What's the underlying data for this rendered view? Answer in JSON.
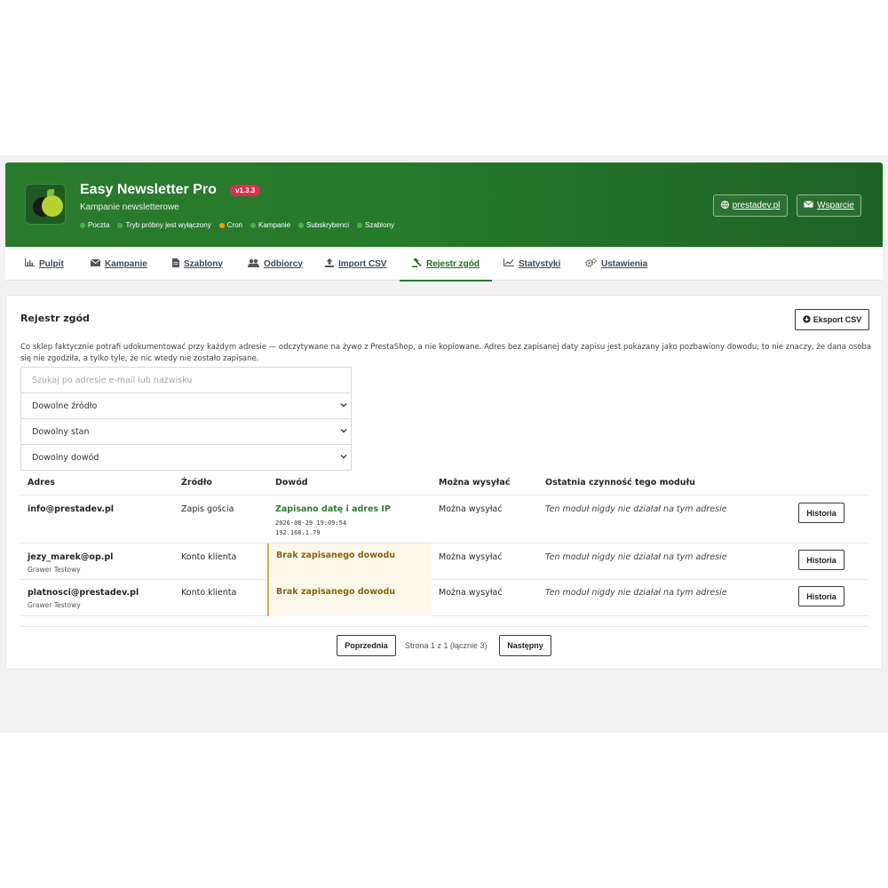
{
  "header": {
    "title": "Easy Newsletter Pro",
    "version": "v1.3.3",
    "subtitle": "Kampanie newsletterowe",
    "status": [
      {
        "label": "Poczta",
        "color": "#4caf50"
      },
      {
        "label": "Tryb próbny jest wyłączony",
        "color": "#4caf50"
      },
      {
        "label": "Cron",
        "color": "#ff9800"
      },
      {
        "label": "Kampanie",
        "color": "#4caf50"
      },
      {
        "label": "Subskrybenci",
        "color": "#4caf50"
      },
      {
        "label": "Szablony",
        "color": "#4caf50"
      }
    ],
    "site_link": "prestadev.pl",
    "support_link": "Wsparcie"
  },
  "tabs": [
    {
      "label": "Pulpit",
      "icon": "bar-chart-icon"
    },
    {
      "label": "Kampanie",
      "icon": "envelope-icon"
    },
    {
      "label": "Szablony",
      "icon": "document-icon"
    },
    {
      "label": "Odbiorcy",
      "icon": "users-icon"
    },
    {
      "label": "Import CSV",
      "icon": "upload-icon"
    },
    {
      "label": "Rejestr zgód",
      "icon": "gavel-icon",
      "active": true
    },
    {
      "label": "Statystyki",
      "icon": "line-chart-icon"
    },
    {
      "label": "Ustawienia",
      "icon": "gears-icon"
    }
  ],
  "panel": {
    "title": "Rejestr zgód",
    "export_label": "Eksport CSV",
    "description": "Co sklep faktycznie potrafi udokumentować przy każdym adresie — odczytywane na żywo z PrestaShop, a nie kopiowane. Adres bez zapisanej daty zapisu jest pokazany jako pozbawiony dowodu; to nie znaczy, że dana osoba się nie zgodziła, a tylko tyle, że nic wtedy nie zostało zapisane."
  },
  "filters": {
    "search_placeholder": "Szukaj po adresie e-mail lub nazwisku",
    "source_selected": "Dowolne źródło",
    "state_selected": "Dowolny stan",
    "proof_selected": "Dowolny dowód"
  },
  "table": {
    "headers": [
      "Adres",
      "Źródło",
      "Dowód",
      "Można wysyłać",
      "Ostatnia czynność tego modułu"
    ],
    "rows": [
      {
        "email": "info@prestadev.pl",
        "name": "",
        "source": "Zapis gościa",
        "proof": "Zapisano datę i adres IP",
        "proof_date": "2026-08-29 19:09:54",
        "proof_ip": "192.168.1.79",
        "proof_ok": true,
        "can_send": "Można wysyłać",
        "last_action": "Ten moduł nigdy nie działał na tym adresie",
        "button": "Historia"
      },
      {
        "email": "jezy_marek@op.pl",
        "name": "Grawer Testowy",
        "source": "Konto klienta",
        "proof": "Brak zapisanego dowodu",
        "proof_ok": false,
        "can_send": "Można wysyłać",
        "last_action": "Ten moduł nigdy nie działał na tym adresie",
        "button": "Historia"
      },
      {
        "email": "platnosci@prestadev.pl",
        "name": "Grawer Testowy",
        "source": "Konto klienta",
        "proof": "Brak zapisanego dowodu",
        "proof_ok": false,
        "can_send": "Można wysyłać",
        "last_action": "Ten moduł nigdy nie działał na tym adresie",
        "button": "Historia"
      }
    ]
  },
  "pager": {
    "prev": "Poprzednia",
    "info": "Strona 1 z 1 (łącznie 3)",
    "next": "Następny"
  },
  "colors": {
    "brand_green": "#267a2c",
    "version_badge": "#d9304f",
    "missing_proof_bg": "#fdf8ea",
    "missing_proof_border": "#d4aa52"
  }
}
